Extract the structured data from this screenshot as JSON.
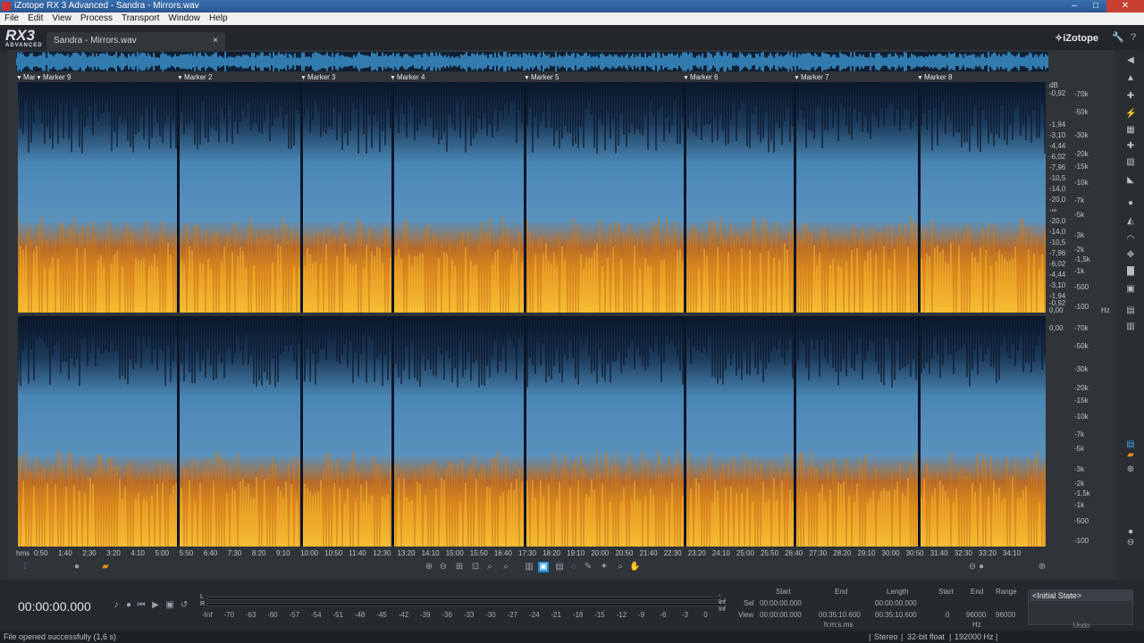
{
  "window": {
    "title": "iZotope RX 3 Advanced - Sandra - Mirrors.wav",
    "min": "–",
    "max": "□",
    "close": "✕"
  },
  "menu": [
    "File",
    "Edit",
    "View",
    "Process",
    "Transport",
    "Window",
    "Help"
  ],
  "logo": {
    "main": "RX3",
    "sub": "ADVANCED"
  },
  "brand": "iZotope",
  "file_tab": {
    "label": "Sandra - Mirrors.wav",
    "close": "×"
  },
  "markers": [
    "Mar",
    "Marker 9",
    "Marker 2",
    "Marker 3",
    "Marker 4",
    "Marker 5",
    "Marker 6",
    "Marker 7",
    "Marker 8"
  ],
  "db_scale": [
    "dB",
    "0,00",
    "-0,92",
    "-1,94",
    "-3,10",
    "-4,44",
    "-6,02",
    "-7,96",
    "-10,5",
    "-14,0",
    "-20,0",
    "-∞",
    "-20,0",
    "-14,0",
    "-10,5",
    "-7,96",
    "-6,02",
    "-4,44",
    "-3,10",
    "-1,94",
    "-0,92",
    "0,00"
  ],
  "hz_scale_top": [
    "-70k",
    "-50k",
    "-30k",
    "-20k",
    "-15k",
    "-10k",
    "-7k",
    "-5k",
    "-3k",
    "-2k",
    "-1,5k",
    "-1k",
    "-500",
    "-100",
    "Hz"
  ],
  "hz_scale_bot": [
    "-70k",
    "-50k",
    "-30k",
    "-20k",
    "-15k",
    "-10k",
    "-7k",
    "-5k",
    "-3k",
    "-2k",
    "-1,5k",
    "-1k",
    "-500",
    "-100"
  ],
  "time_axis": [
    "hms",
    "0:50",
    "1:40",
    "2:30",
    "3:20",
    "4:10",
    "5:00",
    "5:50",
    "6:40",
    "7:30",
    "8:20",
    "9:10",
    "10:00",
    "10:50",
    "11:40",
    "12:30",
    "13:20",
    "14:10",
    "15:00",
    "15:50",
    "16:40",
    "17:30",
    "18:20",
    "19:10",
    "20:00",
    "20:50",
    "21:40",
    "22:30",
    "23:20",
    "24:10",
    "25:00",
    "25:50",
    "26:40",
    "27:30",
    "28:20",
    "29:10",
    "30:00",
    "30:50",
    "31:40",
    "32:30",
    "33:20",
    "34:10"
  ],
  "transport": {
    "timecode": "00:00:00.000",
    "icons": [
      "mic-icon",
      "record-icon",
      "rewind-icon",
      "play-icon",
      "play-selection-icon",
      "loop-icon"
    ]
  },
  "meter": {
    "channels": [
      "L",
      "R"
    ],
    "right_labels": [
      "-Inf",
      "-Inf"
    ],
    "scale": [
      "-Inf",
      "-70",
      "-63",
      "-60",
      "-57",
      "-54",
      "-51",
      "-48",
      "-45",
      "-42",
      "-39",
      "-36",
      "-33",
      "-30",
      "-27",
      "-24",
      "-21",
      "-18",
      "-15",
      "-12",
      "-9",
      "-6",
      "-3",
      "0"
    ]
  },
  "selection_view": {
    "headers": [
      "Start",
      "End",
      "Length",
      "Start",
      "End",
      "Range"
    ],
    "sel_label": "Sel",
    "view_label": "View",
    "sel": [
      "00:00:00.000",
      "",
      "00:00:00.000"
    ],
    "view": [
      "00:00:00.000",
      "00:35:10.600",
      "00:35:10.600",
      "0",
      "96000",
      "96000"
    ],
    "time_unit": "h:m:s.ms",
    "hz_unit": "Hz"
  },
  "undo": {
    "item": "<Initial State>",
    "label": "Undo"
  },
  "status": {
    "message": "File opened successfully (1,6 s)",
    "channels": "Stereo",
    "bitdepth": "32-bit float",
    "samplerate": "192000 Hz"
  }
}
